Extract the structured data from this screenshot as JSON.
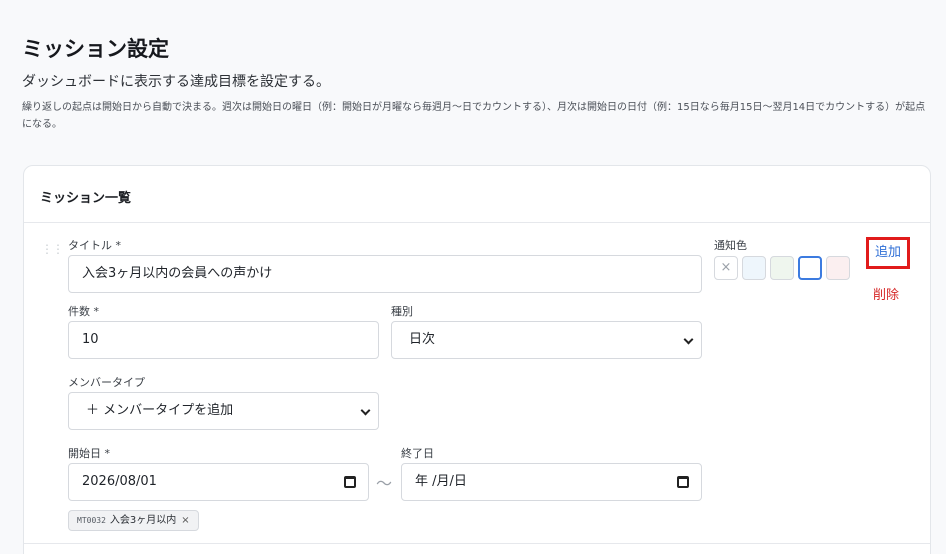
{
  "page": {
    "title": "ミッション設定",
    "subtitle": "ダッシュボードに表示する達成目標を設定する。",
    "note": "繰り返しの起点は開始日から自動で決まる。週次は開始日の曜日（例：開始日が月曜なら毎週月〜日でカウントする）、月次は開始日の日付（例：15日なら毎月15日〜翌月14日でカウントする）が起点になる。"
  },
  "card": {
    "title": "ミッション一覧"
  },
  "mission": {
    "title_label": "タイトル *",
    "title_value": "入会3ヶ月以内の会員への声かけ",
    "count_label": "件数 *",
    "count_value": "10",
    "type_label": "種別",
    "type_value": "日次",
    "member_type_label": "メンバータイプ",
    "member_type_value": "＋ メンバータイプを追加",
    "start_label": "開始日 *",
    "start_value": "2026/08/01",
    "end_label": "終了日",
    "end_value": "年 /月/日",
    "range_separator": "〜",
    "color_label": "通知色",
    "colors": {
      "none_symbol": "×",
      "c1": "#eef6fc",
      "c2": "#eff6ee",
      "c3": "#ffffff",
      "c4": "#fbeff0",
      "selected_border": "#3c7be0"
    },
    "add_label": "追加",
    "delete_label": "削除",
    "tag": {
      "code": "MT0032",
      "label": "入会3ヶ月以内",
      "remove": "×"
    }
  }
}
